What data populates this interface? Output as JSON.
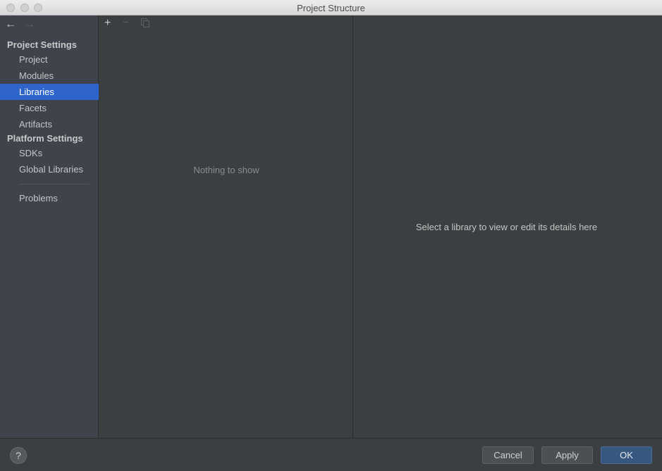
{
  "window": {
    "title": "Project Structure"
  },
  "nav": {
    "back_icon": "←",
    "forward_icon": "→"
  },
  "sidebar": {
    "project_settings_header": "Project Settings",
    "project_items": [
      "Project",
      "Modules",
      "Libraries",
      "Facets",
      "Artifacts"
    ],
    "platform_settings_header": "Platform Settings",
    "platform_items": [
      "SDKs",
      "Global Libraries"
    ],
    "problems": "Problems",
    "selected": "Libraries"
  },
  "list_toolbar": {
    "add_icon": "+",
    "remove_icon": "−"
  },
  "list": {
    "empty_text": "Nothing to show"
  },
  "detail": {
    "placeholder": "Select a library to view or edit its details here"
  },
  "footer": {
    "help": "?",
    "cancel": "Cancel",
    "apply": "Apply",
    "ok": "OK"
  },
  "colors": {
    "selection": "#2f65ca",
    "sidebar_bg": "#3e434c",
    "pane_bg": "#3c3f41",
    "ok_button": "#365880"
  }
}
